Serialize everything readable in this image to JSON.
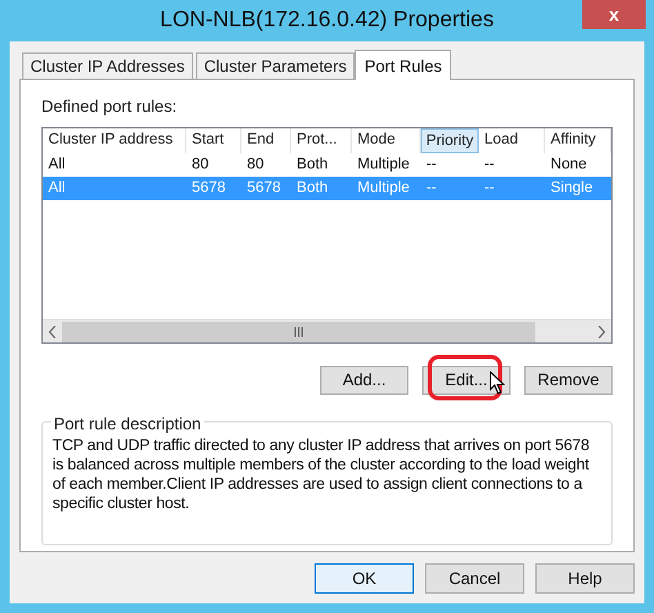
{
  "window": {
    "title": "LON-NLB(172.16.0.42) Properties",
    "close": "x"
  },
  "tabs": [
    {
      "label": "Cluster IP Addresses",
      "selected": false
    },
    {
      "label": "Cluster Parameters",
      "selected": false
    },
    {
      "label": "Port Rules",
      "selected": true
    }
  ],
  "list_label": "Defined port rules:",
  "table": {
    "columns": [
      {
        "label": "Cluster IP address",
        "selected": false
      },
      {
        "label": "Start",
        "selected": false
      },
      {
        "label": "End",
        "selected": false
      },
      {
        "label": "Prot...",
        "selected": false
      },
      {
        "label": "Mode",
        "selected": false
      },
      {
        "label": "Priority",
        "selected": true
      },
      {
        "label": "Load",
        "selected": false
      },
      {
        "label": "Affinity",
        "selected": false
      }
    ],
    "rows": [
      {
        "cells": [
          "All",
          "80",
          "80",
          "Both",
          "Multiple",
          "--",
          "--",
          "None"
        ],
        "selected": false
      },
      {
        "cells": [
          "All",
          "5678",
          "5678",
          "Both",
          "Multiple",
          "--",
          "--",
          "Single"
        ],
        "selected": true
      }
    ]
  },
  "rule_buttons": [
    "Add...",
    "Edit...",
    "Remove"
  ],
  "description": {
    "title": "Port rule description",
    "text": "TCP and UDP traffic directed to any cluster IP address that arrives on port 5678 is balanced across multiple members of the cluster according to the load weight of each member.Client IP addresses are used to assign client connections to a specific cluster host."
  },
  "buttons": [
    {
      "label": "OK",
      "selected": true
    },
    {
      "label": "Cancel",
      "selected": false
    },
    {
      "label": "Help",
      "selected": false
    }
  ]
}
